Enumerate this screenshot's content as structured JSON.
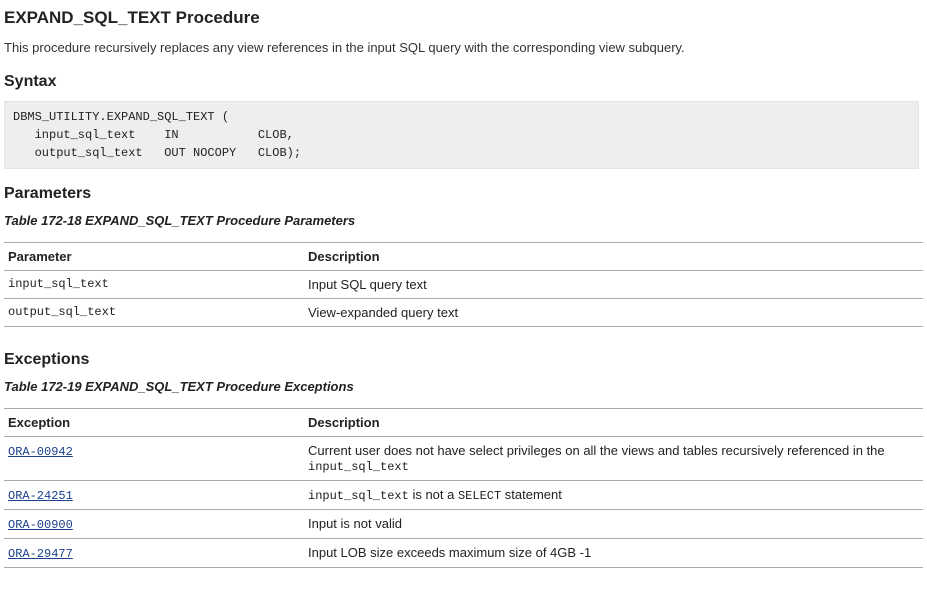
{
  "title": "EXPAND_SQL_TEXT Procedure",
  "description": "This procedure recursively replaces any view references in the input SQL query with the corresponding view subquery.",
  "syntax_heading": "Syntax",
  "syntax_code": "DBMS_UTILITY.EXPAND_SQL_TEXT (\n   input_sql_text    IN           CLOB,\n   output_sql_text   OUT NOCOPY   CLOB);",
  "params_heading": "Parameters",
  "params_table_caption": "Table 172-18 EXPAND_SQL_TEXT Procedure Parameters",
  "params_table": {
    "headers": {
      "c0": "Parameter",
      "c1": "Description"
    },
    "rows": [
      {
        "name": "input_sql_text",
        "desc": "Input SQL query text"
      },
      {
        "name": "output_sql_text",
        "desc": "View-expanded query text"
      }
    ]
  },
  "exceptions_heading": "Exceptions",
  "exceptions_table_caption": "Table 172-19 EXPAND_SQL_TEXT  Procedure Exceptions",
  "exceptions_table": {
    "headers": {
      "c0": "Exception",
      "c1": "Description"
    },
    "rows": [
      {
        "code": "ORA-00942",
        "desc_prefix": "Current user does not have select privileges on all the views and tables recursively referenced in the ",
        "desc_code": "input_sql_text",
        "desc_suffix": ""
      },
      {
        "code": "ORA-24251",
        "desc_prefix": "",
        "desc_code": "input_sql_text",
        "desc_suffix": " is not a ",
        "desc_code2": "SELECT",
        "desc_tail": " statement"
      },
      {
        "code": "ORA-00900",
        "desc_prefix": "Input is not valid",
        "desc_code": "",
        "desc_suffix": ""
      },
      {
        "code": "ORA-29477",
        "desc_prefix": "Input LOB size exceeds maximum size of 4GB -1",
        "desc_code": "",
        "desc_suffix": ""
      }
    ]
  }
}
